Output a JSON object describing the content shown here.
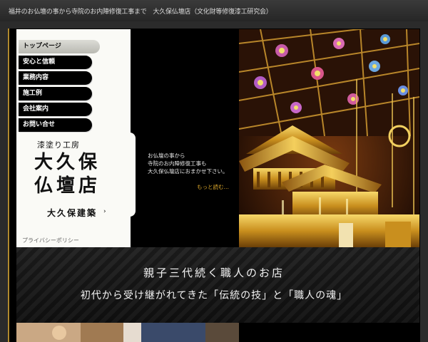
{
  "header": {
    "tagline": "福井のお仏壇の事から寺院のお内陣修復工事まで　大久保仏壇店（文化財等修復漆工研究会）"
  },
  "nav": {
    "items": [
      {
        "label": "トップページ"
      },
      {
        "label": "安心と信頼"
      },
      {
        "label": "業務内容"
      },
      {
        "label": "施工例"
      },
      {
        "label": "会社案内"
      },
      {
        "label": "お問い合せ"
      }
    ],
    "active_index": 0
  },
  "logo": {
    "small": "漆塗り工房",
    "main": "大久保仏壇店",
    "sub": "大久保建築",
    "sub_arrow": "›"
  },
  "privacy_label": "プライバシーポリシー",
  "intro": {
    "lines": [
      "お仏壇の事から",
      "寺院のお内陣修復工事も",
      "大久保仏壇店におまかせ下さい。"
    ],
    "more": "もっと読む…"
  },
  "banner": {
    "line1": "親子三代続く職人のお店",
    "line2": "初代から受け継がれてきた「伝統の技」と「職人の魂」"
  },
  "colors": {
    "accent_gold": "#d9a52a",
    "frame_gold": "#b08a2e",
    "nav_bg": "#000000"
  }
}
